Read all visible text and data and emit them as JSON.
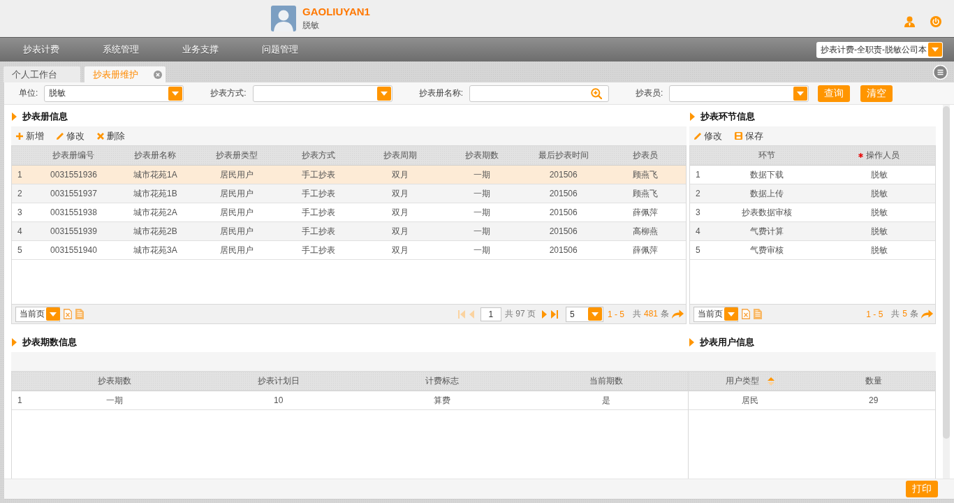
{
  "header": {
    "user_name": "GAOLIUYAN1",
    "user_org": "脱敏"
  },
  "nav": {
    "items": [
      {
        "label": "抄表计费"
      },
      {
        "label": "系统管理"
      },
      {
        "label": "业务支撑"
      },
      {
        "label": "问题管理"
      }
    ],
    "role_select": "抄表计费-全职责-脱敏公司本"
  },
  "tabs": [
    {
      "label": "个人工作台",
      "selected": false,
      "closable": false
    },
    {
      "label": "抄表册维护",
      "selected": true,
      "closable": true
    }
  ],
  "filters": [
    {
      "label": "单位:",
      "kind": "select",
      "value": "脱敏"
    },
    {
      "label": "抄表方式:",
      "kind": "select"
    },
    {
      "label": "抄表册名称:",
      "kind": "search"
    },
    {
      "label": "抄表员:",
      "kind": "select"
    }
  ],
  "filter_buttons": [
    "查询",
    "清空"
  ],
  "book_panel": {
    "title": "抄表册信息",
    "toolbar": [
      {
        "label": "新增",
        "kind": "add"
      },
      {
        "label": "修改",
        "kind": "edit"
      },
      {
        "label": "删除",
        "kind": "delete"
      }
    ],
    "table": {
      "columns": [
        {
          "label": "抄表册编号"
        },
        {
          "label": "抄表册名称"
        },
        {
          "label": "抄表册类型"
        },
        {
          "label": "抄表方式"
        },
        {
          "label": "抄表周期"
        },
        {
          "label": "抄表期数"
        },
        {
          "label": "最后抄表时间"
        },
        {
          "label": "抄表员"
        }
      ],
      "rows": [
        {
          "no": "1",
          "cells": [
            "0031551936",
            "城市花苑1A",
            "居民用户",
            "手工抄表",
            "双月",
            "一期",
            "201506",
            "顾燕飞"
          ],
          "selected": true
        },
        {
          "no": "2",
          "cells": [
            "0031551937",
            "城市花苑1B",
            "居民用户",
            "手工抄表",
            "双月",
            "一期",
            "201506",
            "顾燕飞"
          ],
          "selected": false
        },
        {
          "no": "3",
          "cells": [
            "0031551938",
            "城市花苑2A",
            "居民用户",
            "手工抄表",
            "双月",
            "一期",
            "201506",
            "薛佩萍"
          ],
          "selected": false
        },
        {
          "no": "4",
          "cells": [
            "0031551939",
            "城市花苑2B",
            "居民用户",
            "手工抄表",
            "双月",
            "一期",
            "201506",
            "高柳燕"
          ],
          "selected": false
        },
        {
          "no": "5",
          "cells": [
            "0031551940",
            "城市花苑3A",
            "居民用户",
            "手工抄表",
            "双月",
            "一期",
            "201506",
            "薛佩萍"
          ],
          "selected": false
        }
      ]
    },
    "footer": {
      "page_mode": "当前页",
      "pager": [
        {
          "kind": "first",
          "disabled": true
        },
        {
          "kind": "prev",
          "disabled": true
        },
        {
          "kind": "page_input",
          "value": "1"
        },
        {
          "kind": "page_total",
          "text": "共 97 页"
        },
        {
          "kind": "next",
          "disabled": false
        },
        {
          "kind": "last",
          "disabled": false
        },
        {
          "kind": "page_size",
          "value": "5"
        }
      ],
      "range": "1 - 5",
      "total_prefix": "共",
      "total": "481",
      "total_suffix": "条"
    }
  },
  "step_panel": {
    "title": "抄表环节信息",
    "toolbar": [
      {
        "label": "修改",
        "kind": "edit"
      },
      {
        "label": "保存",
        "kind": "save"
      }
    ],
    "table": {
      "columns": [
        {
          "label": "环节",
          "required": false
        },
        {
          "label": "操作人员",
          "required": true
        }
      ],
      "rows": [
        {
          "no": "1",
          "cells": [
            "数据下载",
            "脱敏"
          ],
          "selected": false
        },
        {
          "no": "2",
          "cells": [
            "数据上传",
            "脱敏"
          ],
          "selected": false
        },
        {
          "no": "3",
          "cells": [
            "抄表数据审核",
            "脱敏"
          ],
          "selected": false
        },
        {
          "no": "4",
          "cells": [
            "气费计算",
            "脱敏"
          ],
          "selected": false
        },
        {
          "no": "5",
          "cells": [
            "气费审核",
            "脱敏"
          ],
          "selected": false
        }
      ]
    },
    "footer": {
      "page_mode": "当前页",
      "range": "1 - 5",
      "total_prefix": "共",
      "total": "5",
      "total_suffix": "条"
    }
  },
  "period_panel": {
    "title": "抄表期数信息",
    "table": {
      "columns": [
        {
          "label": "抄表期数"
        },
        {
          "label": "抄表计划日"
        },
        {
          "label": "计费标志"
        },
        {
          "label": "当前期数"
        }
      ],
      "rows": [
        {
          "no": "1",
          "cells": [
            "一期",
            "10",
            "算费",
            "是"
          ],
          "selected": false
        }
      ]
    }
  },
  "user_panel": {
    "title": "抄表用户信息",
    "table": {
      "columns": [
        {
          "label": "用户类型",
          "sortable": true
        },
        {
          "label": "数量",
          "sortable": false
        }
      ],
      "rows": [
        {
          "cells": [
            "居民",
            "29"
          ],
          "selected": false
        }
      ]
    }
  },
  "print_button": "打印"
}
